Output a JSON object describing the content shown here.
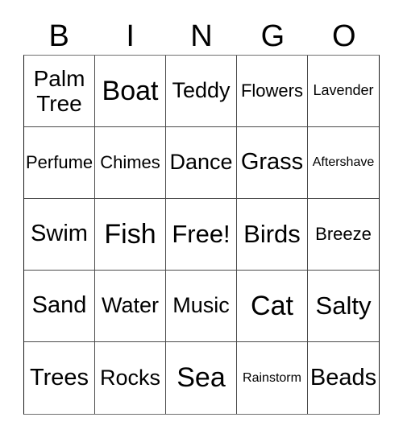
{
  "card": {
    "headers": [
      "B",
      "I",
      "N",
      "G",
      "O"
    ],
    "rows": [
      [
        {
          "text": "Palm Tree",
          "size": "two-line"
        },
        {
          "text": "Boat",
          "size": "fs-xxl"
        },
        {
          "text": "Teddy",
          "size": "fs-m"
        },
        {
          "text": "Flowers",
          "size": "fs-s"
        },
        {
          "text": "Lavender",
          "size": "fs-xs"
        }
      ],
      [
        {
          "text": "Perfume",
          "size": "fs-s"
        },
        {
          "text": "Chimes",
          "size": "fs-s"
        },
        {
          "text": "Dance",
          "size": "fs-m"
        },
        {
          "text": "Grass",
          "size": "fs-l"
        },
        {
          "text": "Aftershave",
          "size": "fs-xxs"
        }
      ],
      [
        {
          "text": "Swim",
          "size": "fs-l"
        },
        {
          "text": "Fish",
          "size": "fs-xxl"
        },
        {
          "text": "Free!",
          "size": "fs-xl"
        },
        {
          "text": "Birds",
          "size": "fs-xl"
        },
        {
          "text": "Breeze",
          "size": "fs-s"
        }
      ],
      [
        {
          "text": "Sand",
          "size": "fs-l"
        },
        {
          "text": "Water",
          "size": "fs-m"
        },
        {
          "text": "Music",
          "size": "fs-m"
        },
        {
          "text": "Cat",
          "size": "fs-xxl"
        },
        {
          "text": "Salty",
          "size": "fs-xl"
        }
      ],
      [
        {
          "text": "Trees",
          "size": "fs-l"
        },
        {
          "text": "Rocks",
          "size": "fs-m"
        },
        {
          "text": "Sea",
          "size": "fs-xxl"
        },
        {
          "text": "Rainstorm",
          "size": "fs-xxs"
        },
        {
          "text": "Beads",
          "size": "fs-l"
        }
      ]
    ],
    "free_space": {
      "row": 2,
      "col": 2,
      "label": "Free!"
    },
    "colors": {
      "background": "#ffffff",
      "text": "#000000",
      "grid_line": "#4a4a4a",
      "grid_outer": "#1a1a1a"
    }
  }
}
